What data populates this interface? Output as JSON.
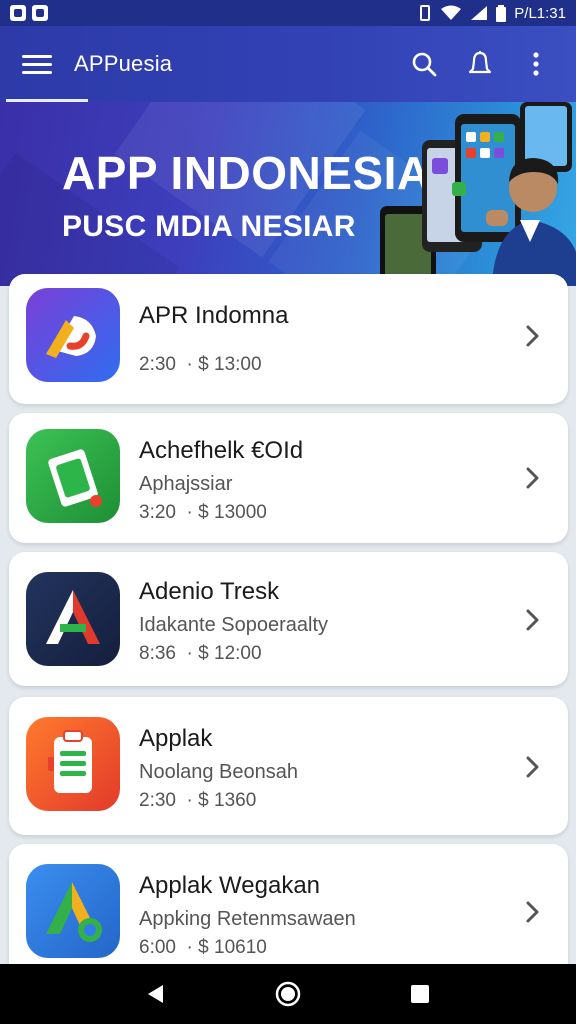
{
  "status_bar": {
    "time": "P/L1:31",
    "icons": [
      "notification-icon",
      "notification-icon",
      "vibrate-icon",
      "wifi-icon",
      "signal-icon",
      "battery-icon"
    ]
  },
  "app_bar": {
    "title": "APPuesia",
    "icons": [
      "menu-icon",
      "search-icon",
      "bell-icon",
      "more-vert-icon"
    ]
  },
  "banner": {
    "title": "APP INDONESIA",
    "subtitle": "PUSC MDIA NESIAR"
  },
  "apps": [
    {
      "name": "APR Indomna",
      "desc": "",
      "time": "2:30",
      "price": "$ 13:00",
      "icon": "app-logo-icon",
      "colors": [
        "#6a3fd8",
        "#2f6df0",
        "#ffffff"
      ]
    },
    {
      "name": "Achefhelk €OId",
      "desc": "Aphajssiar",
      "time": "3:20",
      "price": "$ 13000",
      "icon": "money-app-icon",
      "colors": [
        "#2eb54a",
        "#1e8f35",
        "#ffffff"
      ]
    },
    {
      "name": "Adenio Tresk",
      "desc": "Idakante Sopoeraalty",
      "time": "8:36",
      "price": "$ 12:00",
      "icon": "letter-a-app-icon",
      "colors": [
        "#1b2a52",
        "#e03a2f",
        "#ffffff"
      ]
    },
    {
      "name": "Applak",
      "desc": "Noolang Beonsah",
      "time": "2:30",
      "price": "$ 1360",
      "icon": "clipboard-app-icon",
      "colors": [
        "#ff6a2b",
        "#e8402a",
        "#ffffff"
      ]
    },
    {
      "name": "Applak Wegakan",
      "desc": "Appking Retenmsawaen",
      "time": "6:00",
      "price": "$ 10610",
      "icon": "maps-app-icon",
      "colors": [
        "#2f7de8",
        "#34b04a",
        "#f2b01e"
      ]
    }
  ],
  "nav_bar": {
    "icons": [
      "back-icon",
      "home-icon",
      "recents-icon"
    ]
  },
  "colors": {
    "app_bar": "#3243b6",
    "status_bar": "#1f2f8a",
    "background": "#e4e9ef"
  }
}
